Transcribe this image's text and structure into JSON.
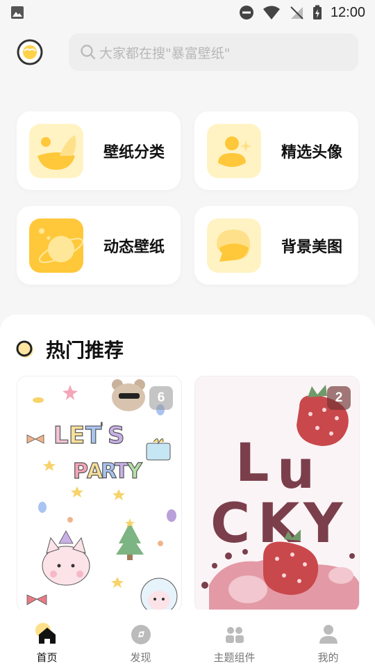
{
  "status": {
    "time": "12:00"
  },
  "search": {
    "placeholder": "大家都在搜\"暴富壁纸\""
  },
  "categories": [
    {
      "label": "壁纸分类",
      "icon": "wallpaper-category-icon"
    },
    {
      "label": "精选头像",
      "icon": "avatar-icon"
    },
    {
      "label": "动态壁纸",
      "icon": "planet-icon"
    },
    {
      "label": "背景美图",
      "icon": "chat-bubble-icon"
    }
  ],
  "section": {
    "title": "热门推荐"
  },
  "recommendations": [
    {
      "count": "6",
      "art_text": "LET'S PARTY"
    },
    {
      "count": "2",
      "art_text": "LUCKY"
    }
  ],
  "tabs": [
    {
      "label": "首页",
      "icon": "home-icon",
      "active": true
    },
    {
      "label": "发现",
      "icon": "discover-icon",
      "active": false
    },
    {
      "label": "主题组件",
      "icon": "widgets-icon",
      "active": false
    },
    {
      "label": "我的",
      "icon": "profile-icon",
      "active": false
    }
  ],
  "colors": {
    "accent": "#ffd24a",
    "accent_light": "#fff3c4",
    "accent_dark": "#f3b534",
    "text": "#111111"
  }
}
